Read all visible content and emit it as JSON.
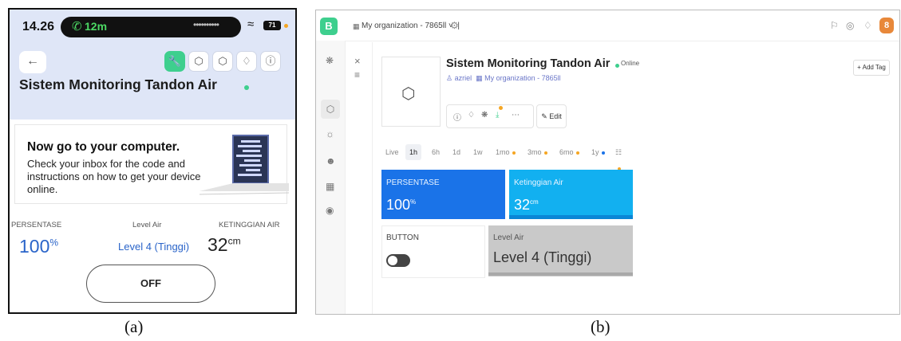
{
  "captions": {
    "a": "(a)",
    "b": "(b)"
  },
  "phone": {
    "status_bar": {
      "time": "14.26",
      "call": "12m",
      "battery": "71"
    },
    "title": "Sistem Monitoring Tandon Air",
    "card": {
      "title": "Now go to your computer.",
      "body": "Check your inbox for the code and instructions on how to get your device online."
    },
    "readings": {
      "persentase_label": "PERSENTASE",
      "persentase_value": "100",
      "persentase_unit": "%",
      "level_label": "Level Air",
      "level_value": "Level 4 (Tinggi)",
      "ketinggian_label": "KETINGGIAN AIR",
      "ketinggian_value": "32",
      "ketinggian_unit": "cm"
    },
    "button_label": "OFF",
    "accent": "#3ecf8e"
  },
  "web": {
    "logo": "B",
    "org": "My organization - 7865ll",
    "device": {
      "title": "Sistem Monitoring Tandon Air",
      "status": "Online",
      "owner": "azriel",
      "org": "My organization - 7865ll"
    },
    "add_tag": "Add Tag",
    "edit": "Edit",
    "avatar": "8",
    "ranges": [
      {
        "label": "Live",
        "dot": ""
      },
      {
        "label": "1h",
        "dot": ""
      },
      {
        "label": "6h",
        "dot": ""
      },
      {
        "label": "1d",
        "dot": ""
      },
      {
        "label": "1w",
        "dot": ""
      },
      {
        "label": "1mo",
        "dot": "#f5a623"
      },
      {
        "label": "3mo",
        "dot": "#f5a623"
      },
      {
        "label": "6mo",
        "dot": "#f5a623"
      },
      {
        "label": "1y",
        "dot": "#1a73e8"
      },
      {
        "label": "",
        "dot": "#f5a623"
      }
    ],
    "selected_range": "1h",
    "widgets": {
      "persentase": {
        "label": "PERSENTASE",
        "value": "100",
        "unit": "%"
      },
      "ketinggian": {
        "label": "Ketinggian Air",
        "value": "32",
        "unit": "cm"
      },
      "button": {
        "label": "BUTTON",
        "state": "off"
      },
      "level": {
        "label": "Level Air",
        "value": "Level 4 (Tinggi)"
      }
    },
    "colors": {
      "primary": "#1a73e8",
      "secondary": "#12b0f0",
      "grey": "#c9c9c9",
      "accent": "#3ecf8e"
    }
  }
}
